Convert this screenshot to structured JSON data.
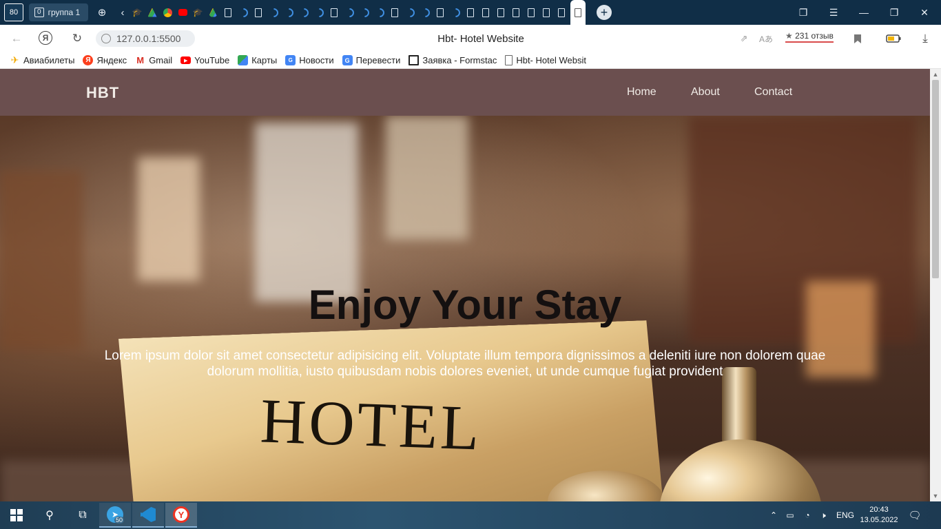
{
  "browser": {
    "tab_counter": "80",
    "group": {
      "count": "0",
      "label": "группа 1"
    },
    "page_title": "Hbt- Hotel Website",
    "url": "127.0.0.1:5500",
    "reviews": {
      "star": "★",
      "label": "231 отзыв"
    }
  },
  "bookmarks": [
    {
      "label": "Авиабилеты",
      "icon": "plane-icon",
      "color": "#f2a900"
    },
    {
      "label": "Яндекс",
      "icon": "yandex-icon",
      "color": "#fc3f1d"
    },
    {
      "label": "Gmail",
      "icon": "gmail-icon",
      "color": "#d93025"
    },
    {
      "label": "YouTube",
      "icon": "youtube-icon",
      "color": "#ff0000"
    },
    {
      "label": "Карты",
      "icon": "maps-icon",
      "color": "#34a853"
    },
    {
      "label": "Новости",
      "icon": "news-icon",
      "color": "#4285f4"
    },
    {
      "label": "Перевести",
      "icon": "translate-icon",
      "color": "#4285f4"
    },
    {
      "label": "Заявка - Formstac",
      "icon": "formstack-icon",
      "color": "#222222"
    },
    {
      "label": "Hbt- Hotel Websit",
      "icon": "page-icon",
      "color": "#666666"
    }
  ],
  "site": {
    "brand": "HBT",
    "nav": [
      {
        "label": "Home"
      },
      {
        "label": "About"
      },
      {
        "label": "Contact"
      }
    ],
    "hero": {
      "title": "Enjoy Your Stay",
      "text": "Lorem ipsum dolor sit amet consectetur adipisicing elit. Voluptate illum tempora dignissimos a deleniti iure non dolorem quae dolorum mollitia, iusto quibusdam nobis dolores eveniet, ut unde cumque fugiat provident",
      "image_sign_text": "HOTEL"
    },
    "colors": {
      "navbar": "#6b4f4f",
      "nav_text": "#f1ece7"
    }
  },
  "taskbar": {
    "telegram_badge": "50",
    "language": "ENG",
    "time": "20:43",
    "date": "13.05.2022"
  }
}
